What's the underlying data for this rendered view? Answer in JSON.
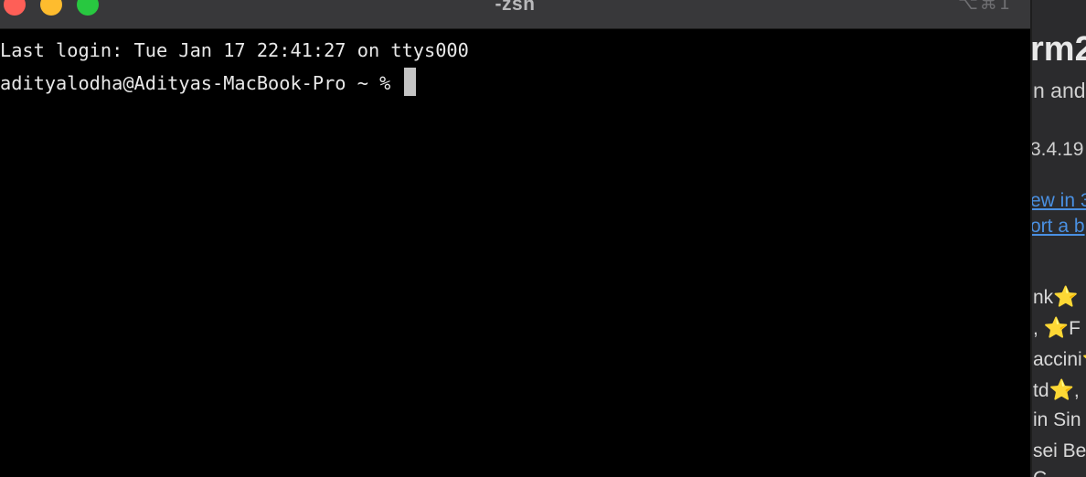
{
  "window": {
    "title": "-zsh",
    "shortcut": "⌥⌘1",
    "traffic_colors": {
      "close": "#fe5f57",
      "minimize": "#febc2e",
      "maximize": "#28c840"
    }
  },
  "terminal": {
    "last_login": "Last login: Tue Jan 17 22:41:27 on ttys000",
    "prompt": "adityalodha@Adityas-MacBook-Pro ~ % "
  },
  "background_doc": {
    "heading": "rm2",
    "subtitle": "n and",
    "version": "3.4.19",
    "links": [
      "ew in 3",
      "ort a b"
    ],
    "rows": [
      {
        "pre": "nk",
        "star": "⭐",
        "post": ""
      },
      {
        "pre": ", ",
        "star": "⭐",
        "post": "F"
      },
      {
        "pre": "accini",
        "star": "⭐",
        "post": ""
      },
      {
        "pre": "td",
        "star": "⭐",
        "post": ","
      },
      {
        "pre": "in Sin",
        "star": "",
        "post": ""
      },
      {
        "pre": "sei Be",
        "star": "",
        "post": ""
      },
      {
        "pre": "C",
        "star": "",
        "post": ""
      }
    ]
  }
}
